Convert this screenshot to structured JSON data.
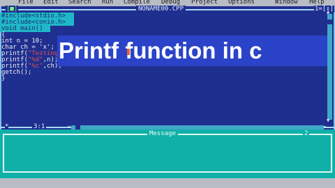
{
  "menu": {
    "items": [
      "File",
      "Edit",
      "Search",
      "Run",
      "Compile",
      "Debug",
      "Project",
      "Options",
      "Window",
      "Help"
    ]
  },
  "editor": {
    "filename": "NONAME00.CPP",
    "close_glyph": "[■]",
    "window_controls": "1=[↕]",
    "position": "3:1",
    "modified_flag": "*",
    "code": {
      "line1": "#include<stdio.h>",
      "line2": "#include<conio.h>",
      "line3": "void main()",
      "line4": "{",
      "line5": "int n = 10;",
      "line6": "char ch = 'x';",
      "line7a": "printf(",
      "line7s": "\"Testing output\"",
      "line7b": ");",
      "line8a": "printf(",
      "line8s": "\"%d\"",
      "line8b": ",n);",
      "line9a": "printf(",
      "line9s": "\"%c\"",
      "line9b": ",ch);",
      "line10": "getch();",
      "line11": "}"
    }
  },
  "overlay": {
    "banner": "Printf function in c"
  },
  "message_window": {
    "title": "Message",
    "number": "2"
  },
  "colors": {
    "editor_bg": "#1f2f8f",
    "selection": "#20b8c8",
    "message_bg": "#0fb0a8",
    "menu_bg": "#b8bcc4",
    "string_literal": "#e05050"
  }
}
